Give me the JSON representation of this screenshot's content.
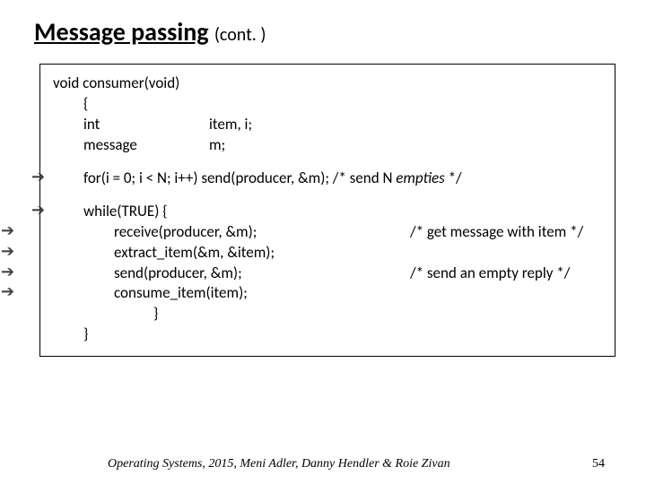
{
  "title": {
    "main": "Message passing",
    "sub": "(cont. )"
  },
  "code": {
    "sig": "void consumer(void)",
    "brace_open": "{",
    "decl_int_kw": "int",
    "decl_int_vars": "item, i;",
    "decl_msg_kw": "message",
    "decl_msg_vars": "m;",
    "for_line": "for(i = 0; i < N; i++) send(producer, &m);  /* send N ",
    "empties": "empties",
    "for_line_end": " */",
    "while_line": "while(TRUE) {",
    "recv": "receive(producer, &m);",
    "recv_c": "/* get message with item */",
    "extract": "extract_item(&m, &item);",
    "send": "send(producer, &m);",
    "send_c": "/* send an empty reply */",
    "consume": "consume_item(item);",
    "inner_close": "}",
    "outer_close": "}"
  },
  "footer": {
    "credits": "Operating Systems, 2015, Meni Adler, Danny Hendler & Roie Zivan",
    "page": "54"
  }
}
